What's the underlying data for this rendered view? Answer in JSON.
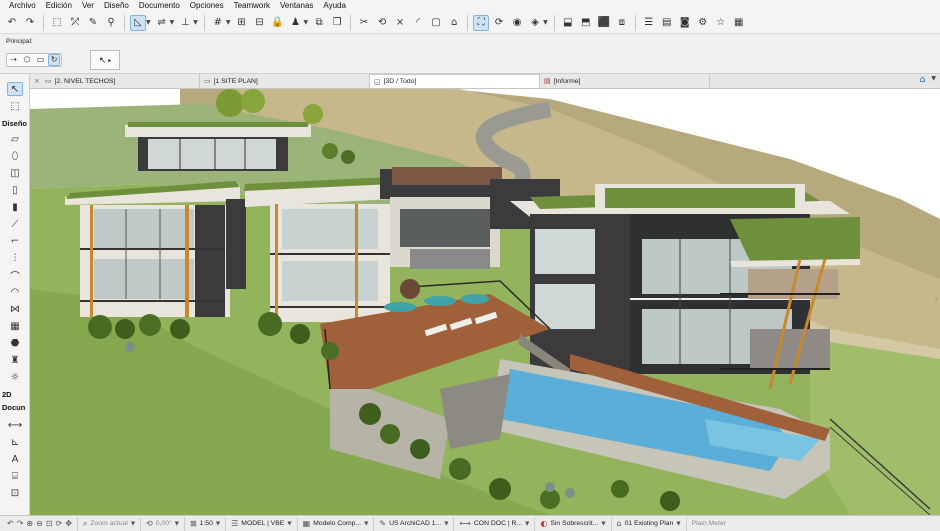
{
  "menu": [
    "Archivo",
    "Edición",
    "Ver",
    "Diseño",
    "Documento",
    "Opciones",
    "Teamwork",
    "Ventanas",
    "Ayuda"
  ],
  "infobox": {
    "label": "Principal:"
  },
  "toolbox": {
    "sections": {
      "design": "Diseño",
      "two_d": "2D",
      "document": "Docun"
    }
  },
  "tabs": [
    {
      "label": "[2. NIVEL TECHOS]",
      "icon": "floor-plan-icon",
      "active": false
    },
    {
      "label": "[1 SITE PLAN]",
      "icon": "layout-icon",
      "active": false
    },
    {
      "label": "[3D / Todo]",
      "icon": "3d-view-icon",
      "active": true
    },
    {
      "label": "[Informe]",
      "icon": "report-icon",
      "active": false
    }
  ],
  "status": {
    "zoom": "Zoom actual",
    "angle": "0,00°",
    "scale": "1:50",
    "model_view": "MODEL | VBE",
    "model_comp": "Modelo Comp...",
    "standard": "US ArchiCAD 1...",
    "con_doc": "CON DOC | R...",
    "override": "Sin Sobrescrit...",
    "existing_plan": "01 Existing Plan",
    "plain_meter": "Plain Meter"
  },
  "colors": {
    "accent": "#1a6fc4",
    "active_tool": "#cfe3f7",
    "roof_green": "#6e8f3c",
    "lawn_green": "#8fb05a",
    "pool_blue": "#5aaed8",
    "deck_wood": "#a0613a",
    "wall_dark": "#3b3b3e",
    "wall_light": "#e9e5dc"
  }
}
